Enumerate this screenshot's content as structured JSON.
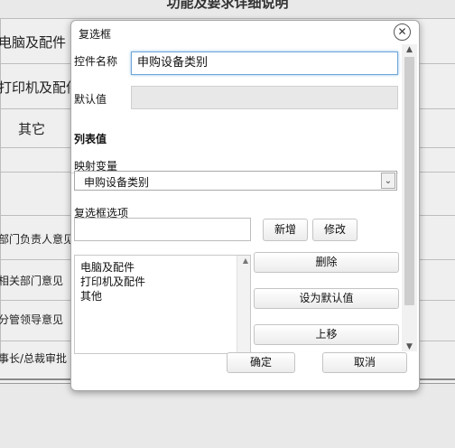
{
  "background": {
    "title": "功能及要求详细说明",
    "rows": [
      {
        "label": "电脑及配件"
      },
      {
        "label": "打印机及配件"
      },
      {
        "label": "其它"
      },
      {
        "label": "部门负责人意见"
      },
      {
        "label": "相关部门意见"
      },
      {
        "label": "分管领导意见"
      },
      {
        "label": "事长/总裁审批"
      }
    ]
  },
  "dialog": {
    "title": "复选框",
    "close_icon": "close-icon",
    "control_name_label": "控件名称",
    "control_name_value": "申购设备类别",
    "default_value_label": "默认值",
    "default_value": "",
    "list_section_title": "列表值",
    "mapping_label": "映射变量",
    "mapping_value": "申购设备类别",
    "options_label": "复选框选项",
    "option_input_value": "",
    "buttons": {
      "add": "新增",
      "modify": "修改",
      "delete": "删除",
      "set_default": "设为默认值",
      "move_up": "上移",
      "ok": "确定",
      "cancel": "取消"
    },
    "options": [
      "电脑及配件",
      "打印机及配件",
      "其他"
    ]
  }
}
